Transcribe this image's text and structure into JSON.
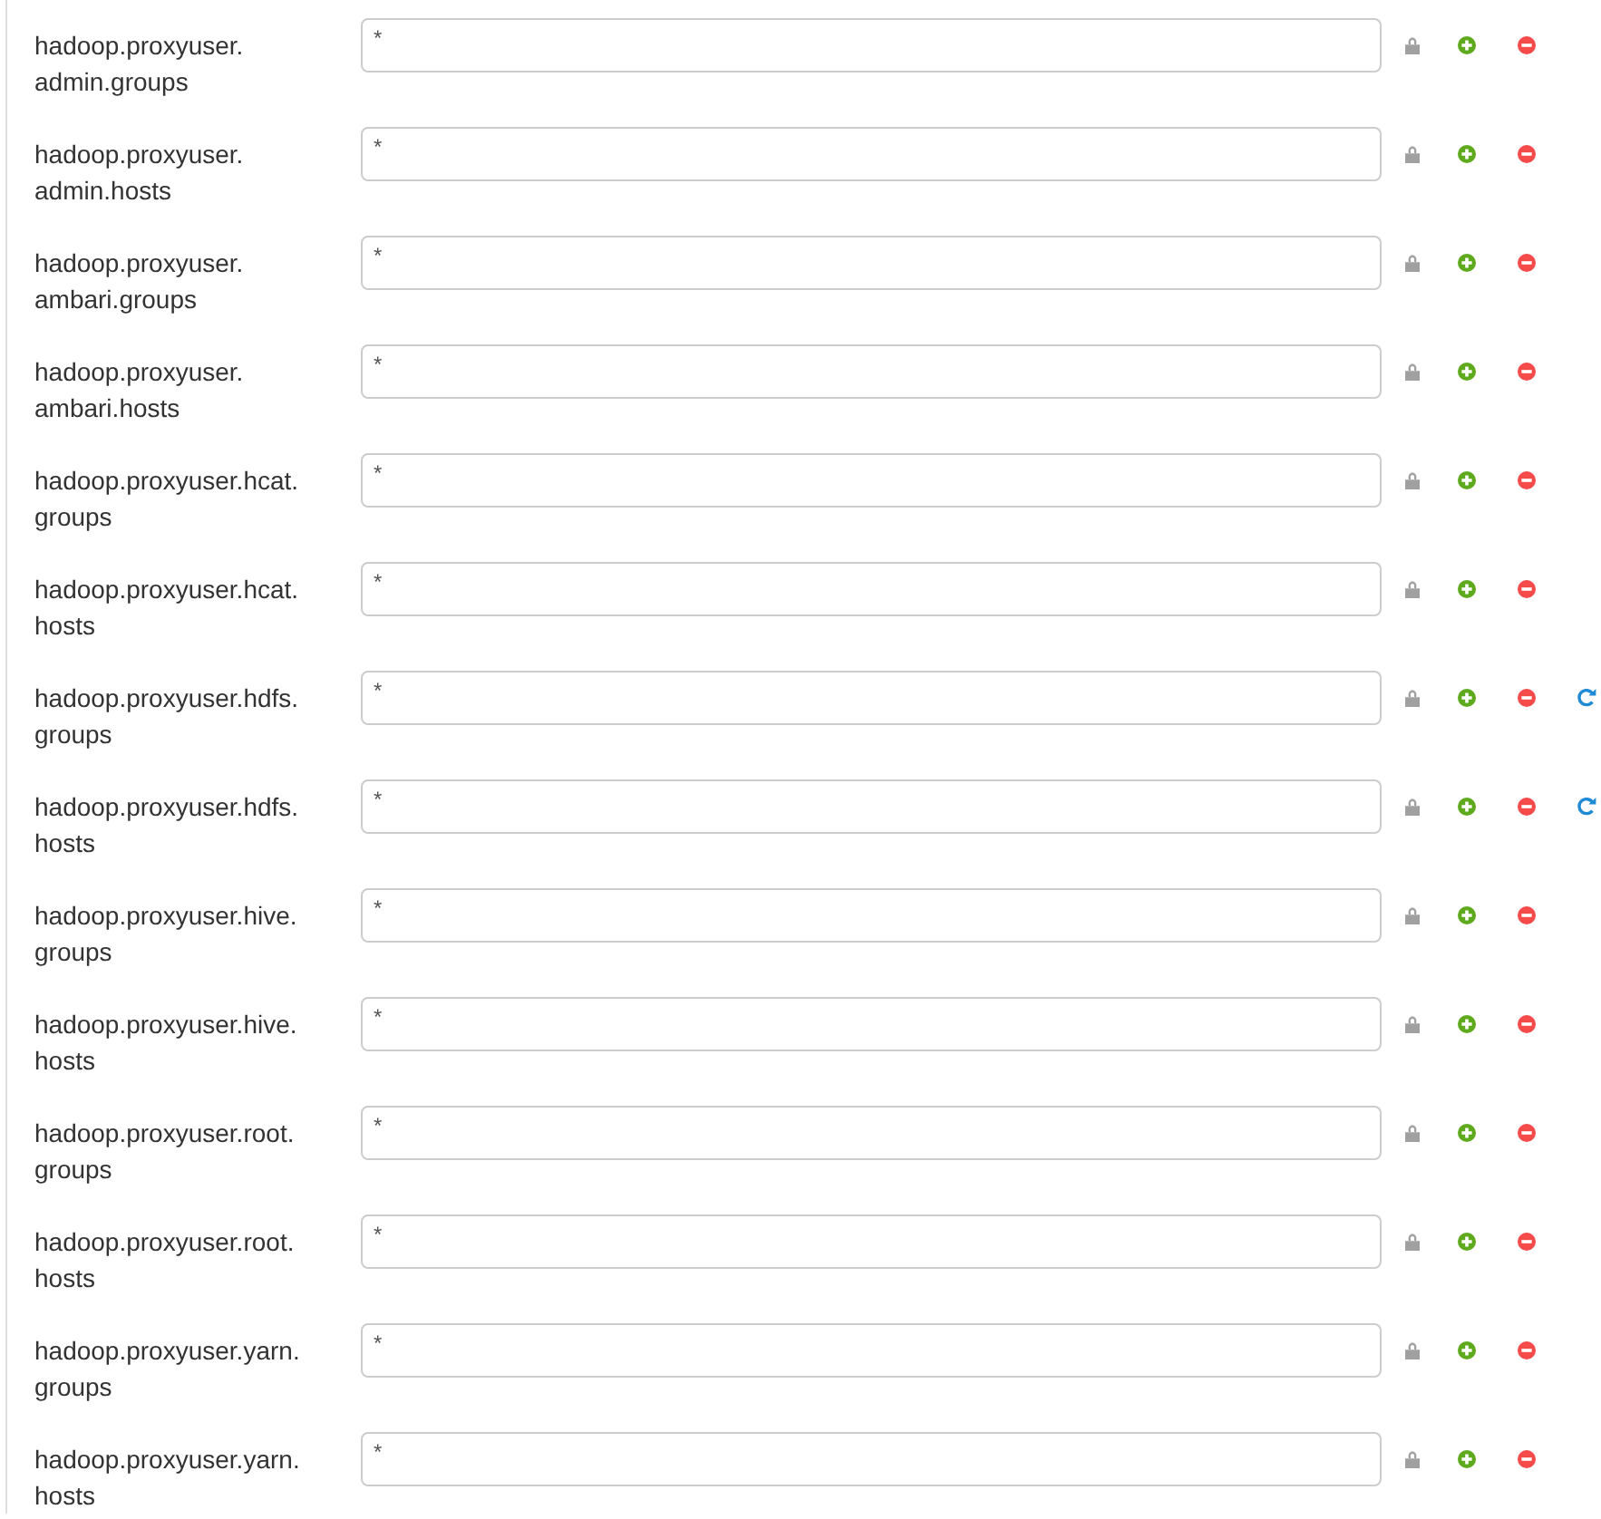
{
  "rows": [
    {
      "label": "hadoop.proxyuser.admin.groups",
      "value": "*",
      "undo": false
    },
    {
      "label": "hadoop.proxyuser.admin.hosts",
      "value": "*",
      "undo": false
    },
    {
      "label": "hadoop.proxyuser.ambari.groups",
      "value": "*",
      "undo": false
    },
    {
      "label": "hadoop.proxyuser.ambari.hosts",
      "value": "*",
      "undo": false
    },
    {
      "label": "hadoop.proxyuser.hcat.groups",
      "value": "*",
      "undo": false
    },
    {
      "label": "hadoop.proxyuser.hcat.hosts",
      "value": "*",
      "undo": false
    },
    {
      "label": "hadoop.proxyuser.hdfs.groups",
      "value": "*",
      "undo": true
    },
    {
      "label": "hadoop.proxyuser.hdfs.hosts",
      "value": "*",
      "undo": true
    },
    {
      "label": "hadoop.proxyuser.hive.groups",
      "value": "*",
      "undo": false
    },
    {
      "label": "hadoop.proxyuser.hive.hosts",
      "value": "*",
      "undo": false
    },
    {
      "label": "hadoop.proxyuser.root.groups",
      "value": "*",
      "undo": false
    },
    {
      "label": "hadoop.proxyuser.root.hosts",
      "value": "*",
      "undo": false
    },
    {
      "label": "hadoop.proxyuser.yarn.groups",
      "value": "*",
      "undo": false
    },
    {
      "label": "hadoop.proxyuser.yarn.hosts",
      "value": "*",
      "undo": false
    }
  ]
}
